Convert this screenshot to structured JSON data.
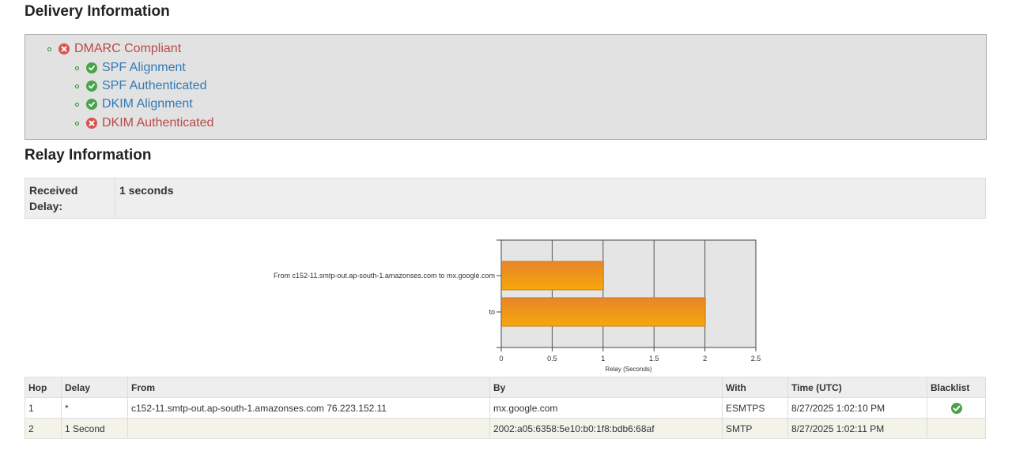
{
  "delivery": {
    "title": "Delivery Information",
    "dmarc": {
      "label": "DMARC Compliant",
      "status": "fail"
    },
    "checks": [
      {
        "label": "SPF Alignment",
        "status": "pass"
      },
      {
        "label": "SPF Authenticated",
        "status": "pass"
      },
      {
        "label": "DKIM Alignment",
        "status": "pass"
      },
      {
        "label": "DKIM Authenticated",
        "status": "fail"
      }
    ]
  },
  "relay": {
    "title": "Relay Information",
    "received_delay_label": "Received Delay:",
    "received_delay_value": "1 seconds"
  },
  "chart_data": {
    "type": "bar",
    "orientation": "horizontal",
    "categories": [
      "From c152-11.smtp-out.ap-south-1.amazonses.com to mx.google.com",
      "to"
    ],
    "values": [
      1,
      2
    ],
    "xlabel": "Relay (Seconds)",
    "ylabel": "",
    "xlim": [
      0,
      2.5
    ],
    "xticks": [
      "0",
      "0.5",
      "1",
      "1.5",
      "2",
      "2.5"
    ],
    "grid": true,
    "bar_color_top": "#e8852a",
    "bar_color_bottom": "#f6a80c"
  },
  "hops": {
    "headers": [
      "Hop",
      "Delay",
      "From",
      "By",
      "With",
      "Time (UTC)",
      "Blacklist"
    ],
    "rows": [
      {
        "hop": "1",
        "delay": "*",
        "from": "c152-11.smtp-out.ap-south-1.amazonses.com 76.223.152.11",
        "by": "mx.google.com",
        "with": "ESMTPS",
        "time": "8/27/2025 1:02:10 PM",
        "blacklist": "check-icon"
      },
      {
        "hop": "2",
        "delay": "1 Second",
        "from": "",
        "by": "2002:a05:6358:5e10:b0:1f8:bdb6:68af",
        "with": "SMTP",
        "time": "8/27/2025 1:02:11 PM",
        "blacklist": ""
      }
    ]
  },
  "colors": {
    "pass": "#47a447",
    "fail": "#d9534f",
    "link": "#337ab7",
    "fail_text": "#b94a48"
  }
}
